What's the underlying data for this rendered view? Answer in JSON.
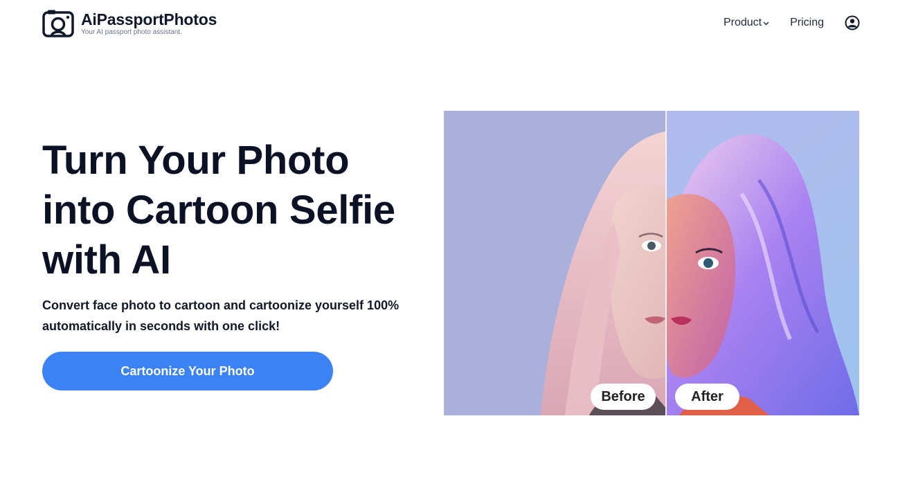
{
  "header": {
    "brand_name": "AiPassportPhotos",
    "brand_tagline": "Your AI passport photo assistant.",
    "nav": {
      "product_label": "Product",
      "pricing_label": "Pricing"
    }
  },
  "hero": {
    "title": "Turn Your Photo into Cartoon Selfie with AI",
    "subtitle": "Convert face photo to cartoon and cartoonize yourself 100% automatically in seconds with one click!",
    "cta_label": "Cartoonize Your Photo"
  },
  "comparison": {
    "before_label": "Before",
    "after_label": "After"
  },
  "icons": {
    "logo": "camera-logo-icon",
    "product_dropdown": "chevron-down-icon",
    "account": "user-circle-icon"
  },
  "colors": {
    "accent": "#3b82f6",
    "text_dark": "#0b1226",
    "photo_bg_before": "#aab0da",
    "photo_bg_after": "#b5b8ea"
  }
}
